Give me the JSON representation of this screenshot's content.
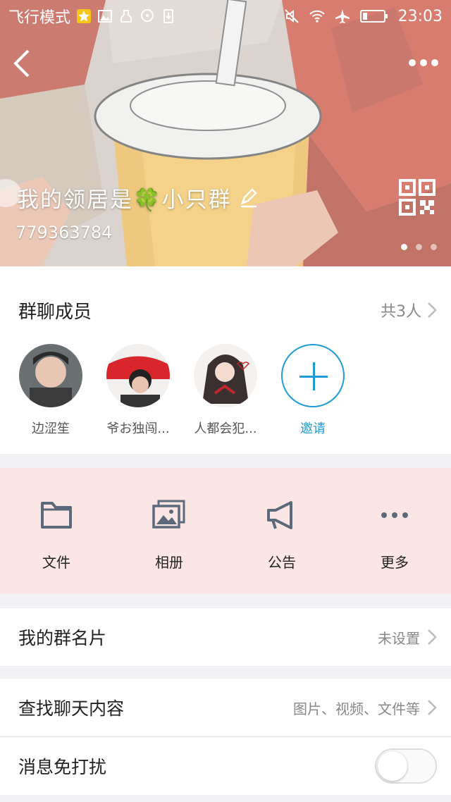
{
  "status_bar": {
    "left_text": "飞行模式",
    "time": "23:03",
    "icons": [
      "star-badge-icon",
      "image-icon",
      "clean-icon",
      "chat-bubble-icon",
      "download-icon",
      "mute-icon",
      "wifi-icon",
      "airplane-icon",
      "battery-icon"
    ]
  },
  "header": {
    "back_icon": "chevron-left-icon",
    "more_icon": "more-dots-icon",
    "group_name": "我的领居是🍀小只群",
    "group_id": "779363784",
    "edit_icon": "pencil-icon",
    "qr_icon": "qr-code-icon",
    "page_indicator": {
      "total": 3,
      "active": 1
    }
  },
  "members": {
    "title": "群聊成员",
    "count_label": "共3人",
    "items": [
      {
        "name": "边涩笙"
      },
      {
        "name": "爷お独闯..."
      },
      {
        "name": "人都会犯..."
      }
    ],
    "invite_label": "邀请"
  },
  "actions": [
    {
      "label": "文件",
      "icon": "folder-icon"
    },
    {
      "label": "相册",
      "icon": "album-icon"
    },
    {
      "label": "公告",
      "icon": "megaphone-icon"
    },
    {
      "label": "更多",
      "icon": "more-dots-icon"
    }
  ],
  "rows": {
    "card": {
      "title": "我的群名片",
      "value": "未设置"
    },
    "search": {
      "title": "查找聊天内容",
      "value": "图片、视频、文件等"
    },
    "mute": {
      "title": "消息免打扰",
      "enabled": false
    }
  },
  "colors": {
    "accent": "#1e9bd8",
    "action_bg": "#fbe6e5"
  }
}
